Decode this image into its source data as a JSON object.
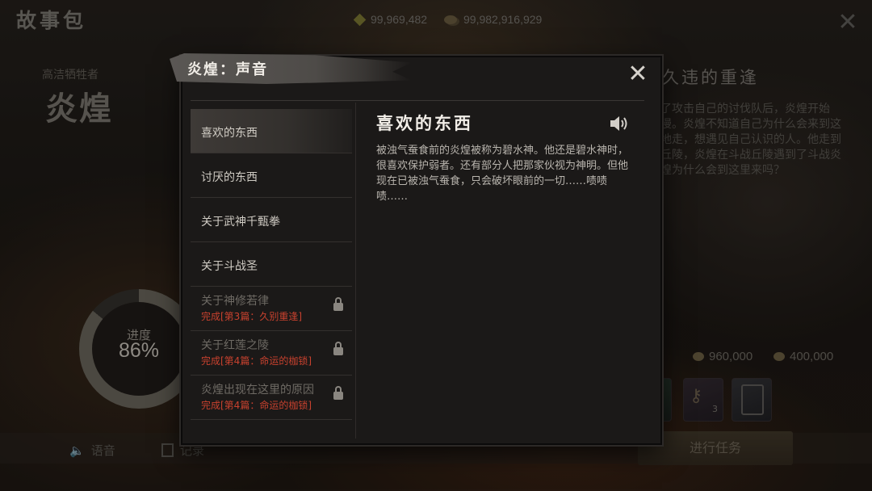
{
  "app": {
    "title": "故事包"
  },
  "currency": [
    {
      "icon": "gem-icon",
      "value": "99,969,482"
    },
    {
      "icon": "coin-icon",
      "value": "99,982,916,929"
    }
  ],
  "character": {
    "subtitle": "高洁牺牲者",
    "name": "炎煌"
  },
  "progress": {
    "label": "进度",
    "value": "86%",
    "fraction": 0.86
  },
  "bottom_bar": {
    "voice_label": "语音",
    "record_label": "记录"
  },
  "chapter": {
    "title": "久违的重逢",
    "text": "了攻击自己的讨伐队后，炎煌开始漫。炎煌不知道自己为什么会来到这地走，想遇见自己认识的人。他走到丘陵，炎煌在斗战丘陵遇到了斗战炎煌为什么会到这里来吗？"
  },
  "rewards": [
    {
      "value": "960,000"
    },
    {
      "value": "400,000"
    }
  ],
  "reward_item_count": "3",
  "quest_button": "进行任务",
  "modal": {
    "title": "炎煌：声音",
    "topics": [
      {
        "label": "喜欢的东西",
        "locked": false,
        "selected": true
      },
      {
        "label": "讨厌的东西",
        "locked": false,
        "selected": false
      },
      {
        "label": "关于武神千甄拳",
        "locked": false,
        "selected": false
      },
      {
        "label": "关于斗战圣",
        "locked": false,
        "selected": false
      },
      {
        "label": "关于神修若律",
        "locked": true,
        "requirement": "完成[第3篇：久别重逢]"
      },
      {
        "label": "关于红莲之陵",
        "locked": true,
        "requirement": "完成[第4篇：命运的枷锁]"
      },
      {
        "label": "炎煌出现在这里的原因",
        "locked": true,
        "requirement": "完成[第4篇：命运的枷锁]"
      }
    ],
    "detail": {
      "title": "喜欢的东西",
      "text": "被浊气蚕食前的炎煌被称为碧水神。他还是碧水神时，很喜欢保护弱者。还有部分人把那家伙视为神明。但他现在已被浊气蚕食，只会破坏眼前的一切……啧啧啧……"
    }
  },
  "colors": {
    "locked_requirement": "#c8412e",
    "modal_bg": "#1b1918"
  }
}
